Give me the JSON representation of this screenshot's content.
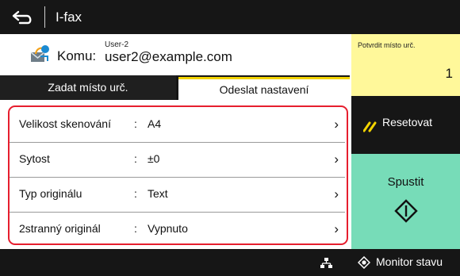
{
  "title_bar": {
    "title": "I-fax",
    "back_icon": "back-arrow-icon"
  },
  "recipient": {
    "icon": "email-recipient-icon",
    "label": "Komu:",
    "user": "User-2",
    "email": "user2@example.com"
  },
  "confirm": {
    "label": "Potvrdit místo urč.",
    "count": "1"
  },
  "tabs": [
    {
      "label": "Zadat místo urč.",
      "selected": false
    },
    {
      "label": "Odeslat nastavení",
      "selected": true
    }
  ],
  "settings": [
    {
      "label": "Velikost skenování",
      "colon": ":",
      "value": "A4",
      "chevron": "›"
    },
    {
      "label": "Sytost",
      "colon": ":",
      "value": "±0",
      "chevron": "›"
    },
    {
      "label": "Typ originálu",
      "colon": ":",
      "value": "Text",
      "chevron": "›"
    },
    {
      "label": "2stranný originál",
      "colon": ":",
      "value": "Vypnuto",
      "chevron": "›"
    }
  ],
  "actions": {
    "reset_label": "Resetovat",
    "reset_icon": "reset-icon",
    "start_label": "Spustit",
    "start_icon": "start-diamond-icon"
  },
  "bottom_bar": {
    "network_icon": "network-icon",
    "monitor_label": "Monitor stavu",
    "monitor_icon": "status-monitor-icon"
  },
  "colors": {
    "bar_dark": "#161616",
    "confirm_bg": "#fff89a",
    "start_bg": "#77dcb8",
    "selection_outline": "#e61e2e",
    "tab_accent": "#f3d400"
  }
}
